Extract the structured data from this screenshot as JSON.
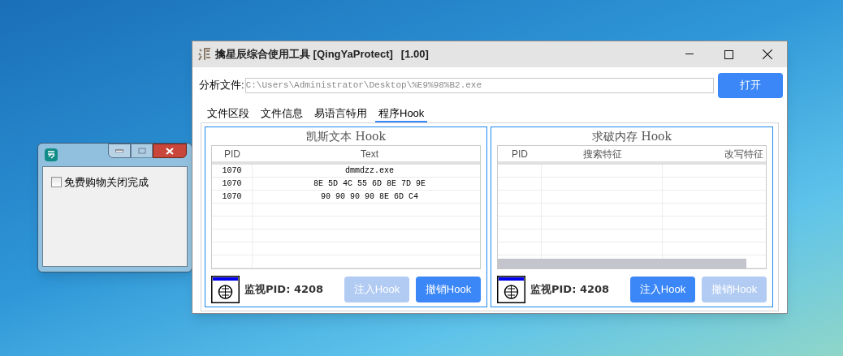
{
  "small_window": {
    "checkbox": {
      "label": "免费购物关闭完成",
      "checked": false
    }
  },
  "main_window": {
    "title": "擒星辰综合使用工具 [QingYaProtect]",
    "version": "[1.00]",
    "file_field": {
      "label": "分析文件:",
      "value": "C:\\Users\\Administrator\\Desktop\\%E9%98%B2.exe"
    },
    "open_button": "打开",
    "tabs": [
      {
        "label": "文件区段",
        "selected": false
      },
      {
        "label": "文件信息",
        "selected": false
      },
      {
        "label": "易语言特用",
        "selected": false
      },
      {
        "label": "程序Hook",
        "selected": true
      }
    ],
    "panels": [
      {
        "title": "凯斯文本 Hook",
        "columns": [
          "PID",
          "Text"
        ],
        "rows": [
          [
            "1070",
            "dmmdzz.exe"
          ],
          [
            "1070",
            "8E 5D 4C 55 6D 8E 7D 9E"
          ],
          [
            "1070",
            "90 90 90 90 8E 6D C4"
          ]
        ],
        "monitor": "监视PID: 4208",
        "buttons": [
          {
            "label": "注入Hook",
            "disabled": true
          },
          {
            "label": "撤销Hook",
            "disabled": false
          }
        ]
      },
      {
        "title": "求破内存 Hook",
        "columns": [
          "PID",
          "搜索特征",
          "改写特征"
        ],
        "monitor": "监视PID: 4208",
        "buttons": [
          {
            "label": "注入Hook",
            "disabled": false
          },
          {
            "label": "撤销Hook",
            "disabled": true
          }
        ]
      }
    ]
  }
}
